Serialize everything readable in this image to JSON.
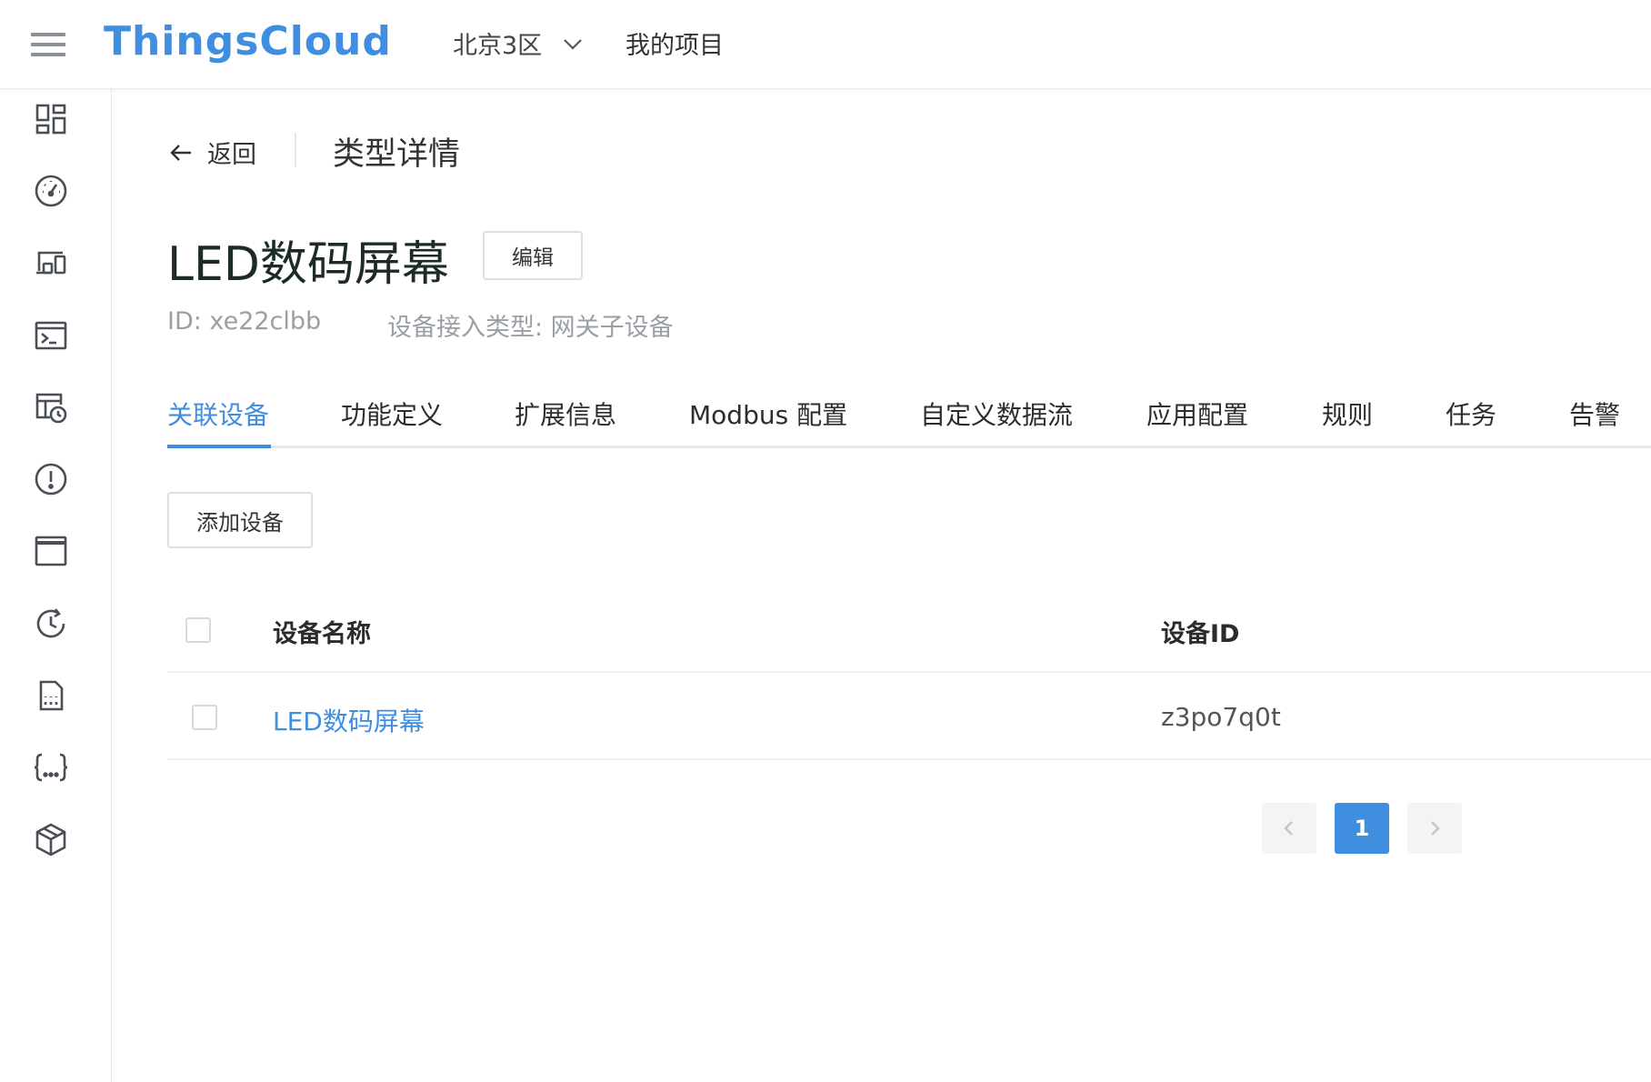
{
  "header": {
    "logo": "ThingsCloud",
    "region": "北京3区",
    "project": "我的项目"
  },
  "sidebar": {
    "icons": [
      "dashboard-icon",
      "gauge-icon",
      "devices-icon",
      "terminal-icon",
      "schedule-icon",
      "alert-icon",
      "window-icon",
      "history-icon",
      "sim-card-icon",
      "code-braces-icon",
      "package-icon"
    ]
  },
  "breadcrumb": {
    "back_label": "返回",
    "page_title": "类型详情"
  },
  "device_type": {
    "name": "LED数码屏幕",
    "edit_label": "编辑",
    "id_text": "ID: xe22clbb",
    "access_type_text": "设备接入类型: 网关子设备"
  },
  "tabs": [
    {
      "label": "关联设备",
      "active": true
    },
    {
      "label": "功能定义"
    },
    {
      "label": "扩展信息"
    },
    {
      "label": "Modbus 配置"
    },
    {
      "label": "自定义数据流"
    },
    {
      "label": "应用配置"
    },
    {
      "label": "规则"
    },
    {
      "label": "任务"
    },
    {
      "label": "告警"
    }
  ],
  "toolbar": {
    "add_device_label": "添加设备"
  },
  "table": {
    "columns": [
      "设备名称",
      "设备ID"
    ],
    "rows": [
      {
        "name": "LED数码屏幕",
        "id": "z3po7q0t"
      }
    ]
  },
  "pagination": {
    "current_page": "1"
  },
  "colors": {
    "accent": "#3f8ee0",
    "text": "#2b2b2b",
    "muted": "#9a9fa6"
  }
}
